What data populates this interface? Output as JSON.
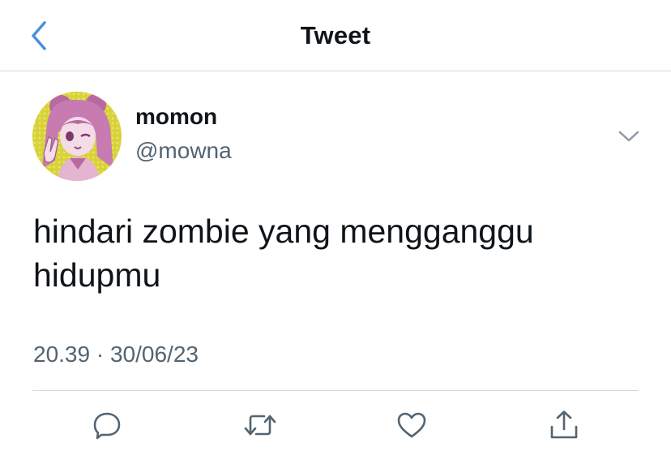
{
  "header": {
    "title": "Tweet",
    "back_icon": "chevron-left-icon",
    "accent_color": "#4a90d9"
  },
  "tweet": {
    "author": {
      "display_name": "momon",
      "handle": "@mowna",
      "avatar": "anime-girl-avatar"
    },
    "text_lines": [
      "hindari zombie yang mengganggu",
      "hidupmu"
    ],
    "time": "20.39",
    "separator": "·",
    "date": "30/06/23",
    "more_icon": "chevron-down-icon"
  },
  "actions": [
    {
      "name": "reply",
      "icon": "reply-icon"
    },
    {
      "name": "retweet",
      "icon": "retweet-icon"
    },
    {
      "name": "like",
      "icon": "heart-icon"
    },
    {
      "name": "share",
      "icon": "share-icon"
    }
  ],
  "colors": {
    "text": "#0f1419",
    "secondary": "#536471",
    "divider": "#d3d6da",
    "icon": "#536471"
  }
}
